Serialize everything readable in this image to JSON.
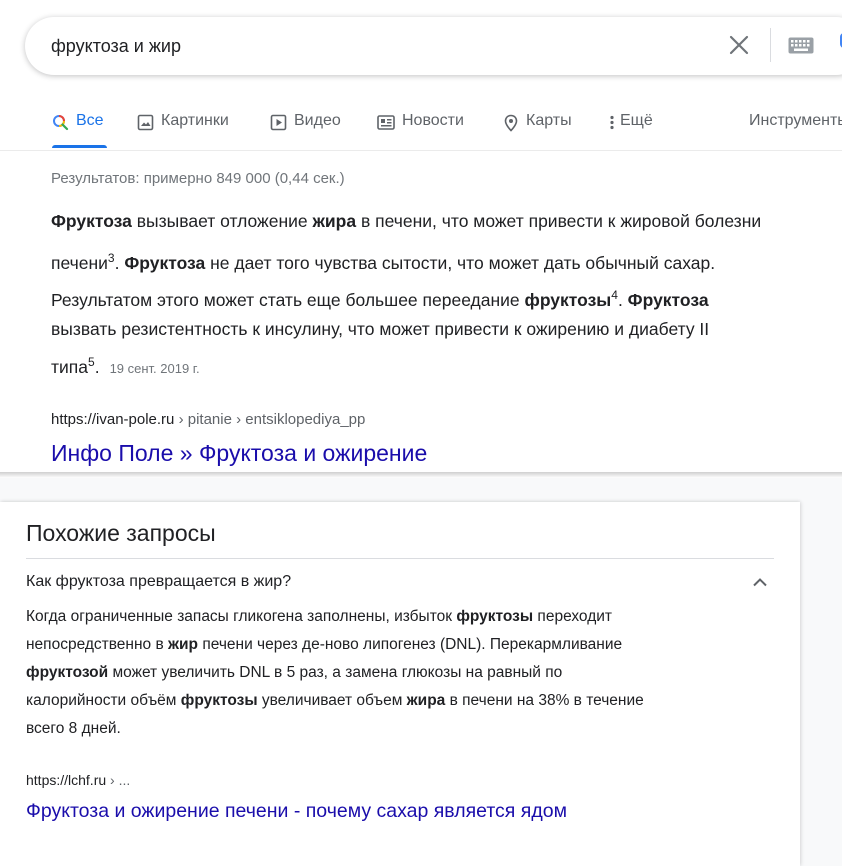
{
  "search": {
    "query": "фруктоза и жир"
  },
  "tabs": [
    {
      "label": "Все",
      "icon": "search-icon",
      "active": true
    },
    {
      "label": "Картинки",
      "icon": "image-icon"
    },
    {
      "label": "Видео",
      "icon": "video-icon"
    },
    {
      "label": "Новости",
      "icon": "news-icon"
    },
    {
      "label": "Карты",
      "icon": "map-pin-icon"
    },
    {
      "label": "Ещё",
      "icon": "more-vert-icon"
    },
    {
      "label": "Инструменты"
    }
  ],
  "result_stats": "Результатов: примерно 849 000 (0,44 сек.)",
  "snippet": {
    "l1_b1": "Фруктоза",
    "l1_t1": " вызывает отложение ",
    "l1_b2": "жира",
    "l1_t2": " в печени, что может привести к жировой болезни",
    "l2_t1": "печени",
    "l2_s1": "3",
    "l2_t2": ". ",
    "l2_b1": "Фруктоза",
    "l2_t3": " не дает того чувства сытости, что может дать обычный сахар.",
    "l3_t1": "Результатом этого может стать еще большее переедание ",
    "l3_b1": "фруктозы",
    "l3_s1": "4",
    "l3_t2": ". ",
    "l3_b2": "Фруктоза",
    "l4_t1": "вызвать резистентность к инсулину, что может привести к ожирению и диабету II",
    "l5_t1": "типа",
    "l5_s1": "5",
    "l5_t2": ".",
    "date": "19 сент. 2019 г."
  },
  "result1": {
    "domain": "https://ivan-pole.ru",
    "path": " › pitanie › entsiklopediya_pp",
    "title": "Инфо Поле » Фруктоза и ожирение"
  },
  "related": {
    "title": "Похожие запросы",
    "question": "Как фруктоза превращается в жир?",
    "answer": {
      "l1_t1": "Когда ограниченные запасы гликогена заполнены, избыток ",
      "l1_b1": "фруктозы",
      "l1_t2": " переходит",
      "l2_t1": "непосредственно в ",
      "l2_b1": "жир",
      "l2_t2": " печени через де-ново липогенез (DNL). Перекармливание",
      "l3_b1": "фруктозой",
      "l3_t1": " может увеличить DNL в 5 раз, а замена глюкозы на равный по",
      "l4_t1": "калорийности объём ",
      "l4_b1": "фруктозы",
      "l4_t2": " увеличивает объем ",
      "l4_b2": "жира",
      "l4_t3": " в печени на 38% в течение",
      "l5_t1": "всего 8 дней."
    },
    "source_domain": "https://lchf.ru",
    "source_path": " › ...",
    "link_title": "Фруктоза и ожирение печени - почему сахар является ядом"
  },
  "colors": {
    "link": "#1a0dab",
    "accent": "#1a73e8",
    "muted": "#70757a"
  }
}
